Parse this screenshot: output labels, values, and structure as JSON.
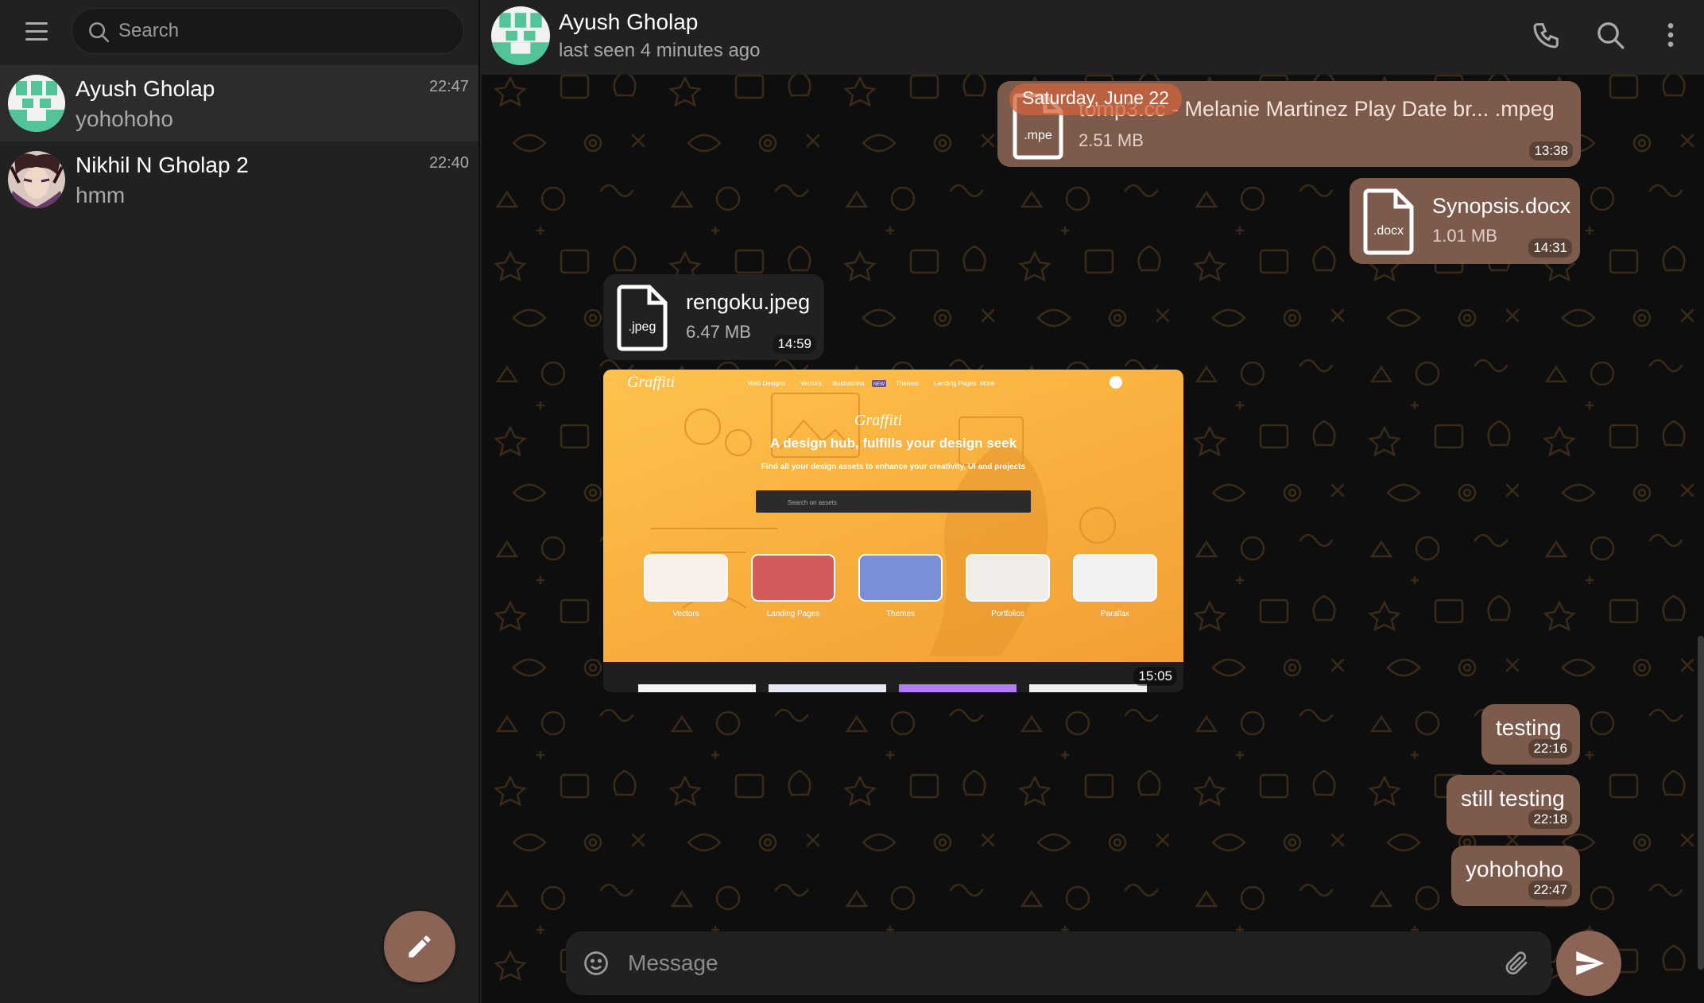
{
  "sidebar": {
    "search_placeholder": "Search",
    "chats": [
      {
        "name": "Ayush Gholap",
        "preview": "yohohoho",
        "time": "22:47",
        "active": true
      },
      {
        "name": "Nikhil N Gholap 2",
        "preview": "hmm",
        "time": "22:40",
        "active": false
      }
    ],
    "icons": {
      "menu": "hamburger-menu-icon",
      "search": "search-icon",
      "compose": "pencil-icon"
    }
  },
  "chat": {
    "contact_name": "Ayush Gholap",
    "contact_status": "last seen 4 minutes ago",
    "icons": {
      "call": "phone-icon",
      "search": "search-icon",
      "more": "more-vertical-icon"
    },
    "date_separator": "Saturday, June 22",
    "messages": [
      {
        "kind": "file",
        "direction": "out",
        "file_name": "tomp3.cc - Melanie Martinez Play Date br... .mpeg",
        "file_ext": ".mpe",
        "file_size": "2.51 MB",
        "time": "13:38"
      },
      {
        "kind": "file",
        "direction": "out",
        "file_name": "Synopsis.docx",
        "file_ext": ".docx",
        "file_size": "1.01 MB",
        "time": "14:31"
      },
      {
        "kind": "file",
        "direction": "in",
        "file_name": "rengoku.jpeg",
        "file_ext": ".jpeg",
        "file_size": "6.47 MB",
        "time": "14:59"
      },
      {
        "kind": "image",
        "direction": "in",
        "time": "15:05"
      },
      {
        "kind": "text",
        "direction": "out",
        "text": "testing",
        "time": "22:16"
      },
      {
        "kind": "text",
        "direction": "out",
        "text": "still testing",
        "time": "22:18"
      },
      {
        "kind": "text",
        "direction": "out",
        "text": "yohohoho",
        "time": "22:47"
      }
    ],
    "composer_placeholder": "Message",
    "composer_icons": {
      "emoji": "emoji-icon",
      "attach": "paperclip-icon",
      "send": "send-icon"
    }
  },
  "screenshot": {
    "brand": "Graffiti",
    "nav": [
      "Web Designs",
      "Vectors",
      "Illustrations",
      "Themes",
      "Landing Pages",
      "More"
    ],
    "badge": "NEW",
    "headline": "A design hub, fulfills your design seek",
    "subheadline": "Find all your design assets to enhance your creativity, UI and projects",
    "search_placeholder": "Search on assets",
    "categories": [
      "Vectors",
      "Landing Pages",
      "Themes",
      "Portfolios",
      "Parallax"
    ]
  },
  "colors": {
    "accent": "#8b6455",
    "bubble_out": "#7c5a4c",
    "panel": "#212121",
    "background": "#0e0e0e",
    "pattern": "#3a2a18",
    "date_pill": "#d2643c"
  }
}
